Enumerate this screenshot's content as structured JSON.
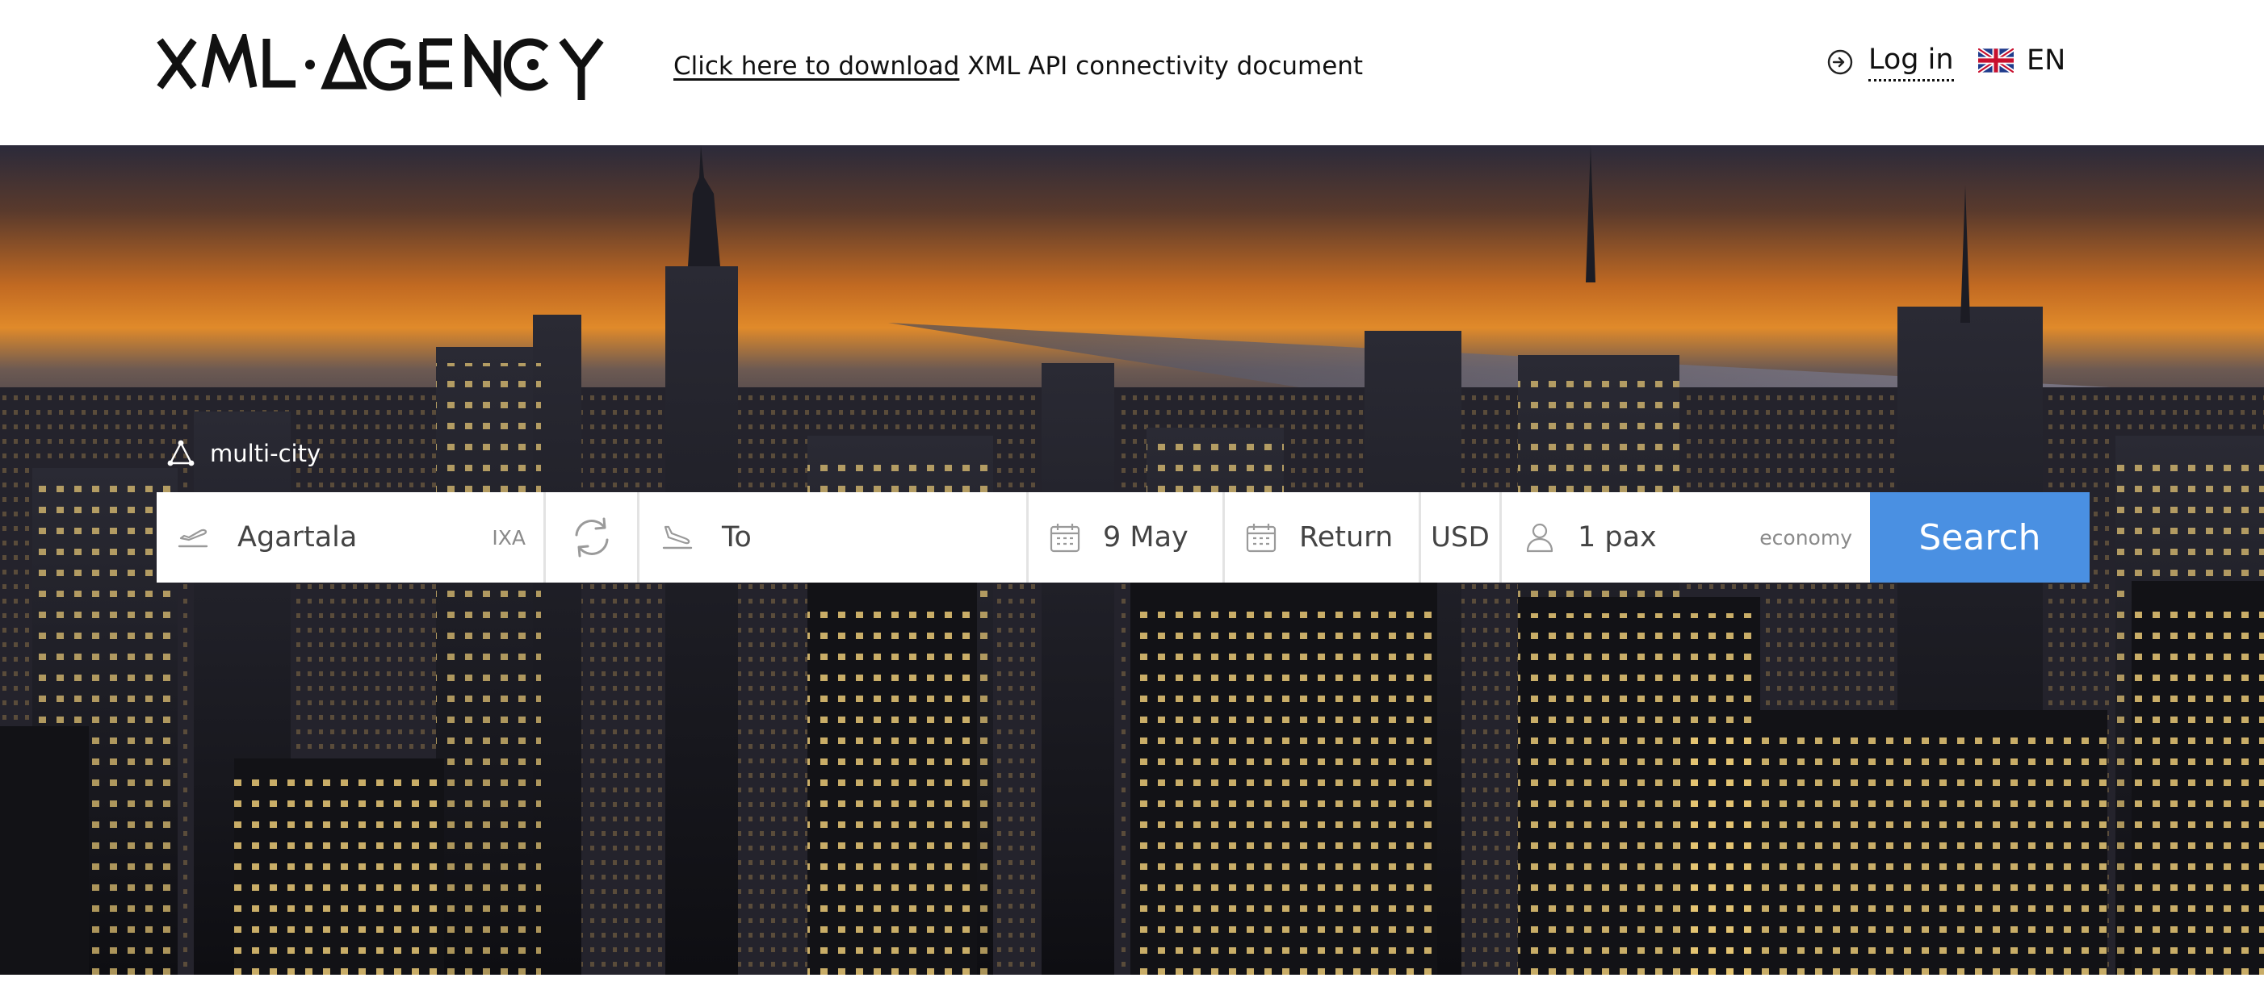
{
  "header": {
    "brand": "XML·AGENCY",
    "download_link": "Click here to download",
    "download_rest": "XML API connectivity document",
    "login_label": "Log in",
    "login_icon": "login-icon",
    "language": "EN",
    "language_icon": "uk-flag-icon"
  },
  "search": {
    "trip_type_label": "multi-city",
    "trip_type_icon": "multi-city-icon",
    "from": {
      "value": "Agartala",
      "code": "IXA",
      "icon": "takeoff-icon"
    },
    "swap_icon": "swap-icon",
    "to": {
      "placeholder": "To",
      "icon": "landing-icon"
    },
    "depart_date": {
      "value": "9 May",
      "icon": "calendar-icon"
    },
    "return_date": {
      "placeholder": "Return",
      "icon": "calendar-icon"
    },
    "currency": "USD",
    "passengers": {
      "value": "1 pax",
      "class": "economy",
      "icon": "person-icon"
    },
    "button_label": "Search"
  },
  "colors": {
    "accent": "#4a90e2",
    "header_bg": "#ffffff",
    "text": "#111111"
  }
}
